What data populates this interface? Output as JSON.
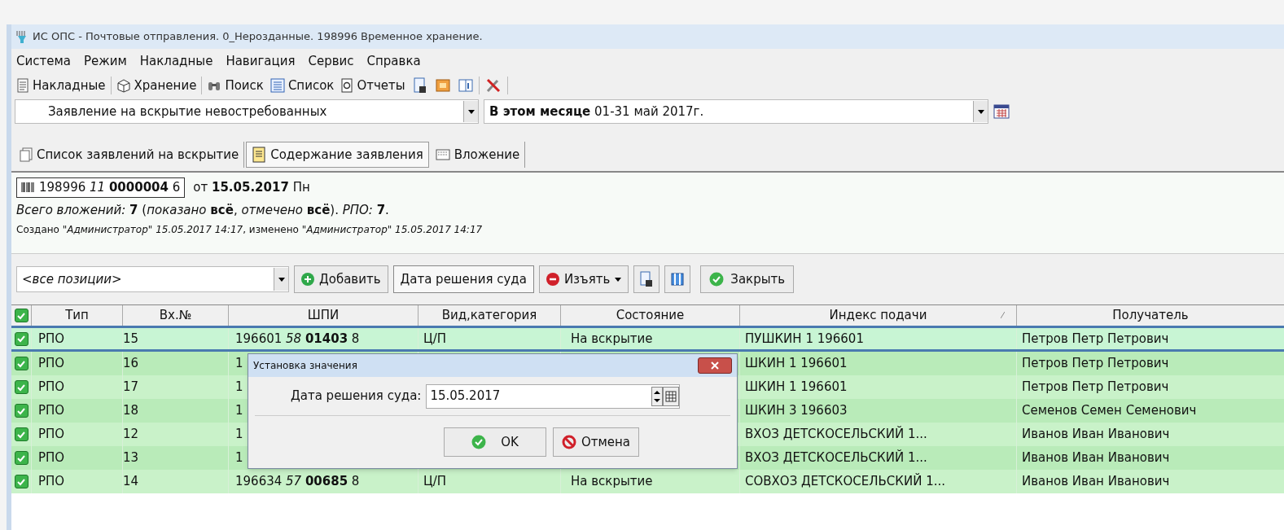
{
  "window": {
    "title": "ИС ОПС - Почтовые отправления. 0_Нерозданные. 198996 Временное хранение."
  },
  "menu": [
    "Система",
    "Режим",
    "Накладные",
    "Навигация",
    "Сервис",
    "Справка"
  ],
  "toolbar": [
    {
      "kind": "text",
      "label": "Накладные"
    },
    {
      "kind": "text",
      "label": "Хранение"
    },
    {
      "kind": "text",
      "label": "Поиск"
    },
    {
      "kind": "text",
      "label": "Список"
    },
    {
      "kind": "text",
      "label": "Отчеты"
    },
    {
      "kind": "icon"
    },
    {
      "kind": "icon"
    },
    {
      "kind": "icon"
    },
    {
      "kind": "icon"
    }
  ],
  "filters": {
    "document_type": "Заявление на вскрытие невостребованных",
    "period": "**В этом месяце** 01-31 май 2017г."
  },
  "tabs": [
    {
      "label": "Список заявлений на вскрытие",
      "selected": false
    },
    {
      "label": "Содержание заявления",
      "selected": true
    },
    {
      "label": "Вложение",
      "selected": false
    }
  ],
  "info": {
    "barcode": "198996 *11* **0000004** 6",
    "date": "от **15.05.2017** Пн",
    "summary": "*Всего вложений:* **7** (*показано* **всё**, *отмечено* **всё**). *РПО:* **7**.",
    "audit": "Создано *\"Администратор\" 15.05.2017 14:17*, изменено *\"Администратор\" 15.05.2017 14:17*"
  },
  "actions": {
    "filter": "<все позиции>",
    "add": "Добавить",
    "court_date": "Дата решения суда",
    "remove": "Изъять",
    "close": "Закрыть"
  },
  "table": {
    "checked": true,
    "columns": [
      "Тип",
      "Вх.№",
      "ШПИ",
      "Вид,категория",
      "Состояние",
      "Индекс подачи",
      "Получатель"
    ],
    "rows": [
      {
        "checked": true,
        "selected": true,
        "cells": [
          "РПО",
          "15",
          "196601 *58* **01403** 8",
          "Ц/П",
          "На вскрытие",
          "ПУШКИН 1 196601",
          "Петров Петр Петрович"
        ]
      },
      {
        "checked": true,
        "selected": false,
        "cells": [
          "РПО",
          "16",
          "1",
          null,
          null,
          "ШКИН 1 196601",
          "Петров Петр Петрович"
        ]
      },
      {
        "checked": true,
        "selected": false,
        "cells": [
          "РПО",
          "17",
          "1",
          null,
          null,
          "ШКИН 1 196601",
          "Петров Петр Петрович"
        ]
      },
      {
        "checked": true,
        "selected": false,
        "cells": [
          "РПО",
          "18",
          "1",
          null,
          null,
          "ШКИН 3 196603",
          "Семенов Семен Семенович"
        ]
      },
      {
        "checked": true,
        "selected": false,
        "cells": [
          "РПО",
          "12",
          "1",
          null,
          null,
          "ВХОЗ ДЕТСКОСЕЛЬСКИЙ 1...",
          "Иванов Иван Иванович"
        ]
      },
      {
        "checked": true,
        "selected": false,
        "cells": [
          "РПО",
          "13",
          "1",
          null,
          null,
          "ВХОЗ ДЕТСКОСЕЛЬСКИЙ 1...",
          "Иванов Иван Иванович"
        ]
      },
      {
        "checked": true,
        "selected": false,
        "cells": [
          "РПО",
          "14",
          "196634 *57* **00685** 8",
          "Ц/П",
          "На вскрытие",
          "СОВХОЗ ДЕТСКОСЕЛЬСКИЙ 1...",
          "Иванов Иван Иванович"
        ]
      }
    ]
  },
  "dialog": {
    "title": "Установка значения",
    "label": "Дата решения суда:",
    "value": "15.05.2017",
    "ok": "OK",
    "cancel": "Отмена"
  }
}
